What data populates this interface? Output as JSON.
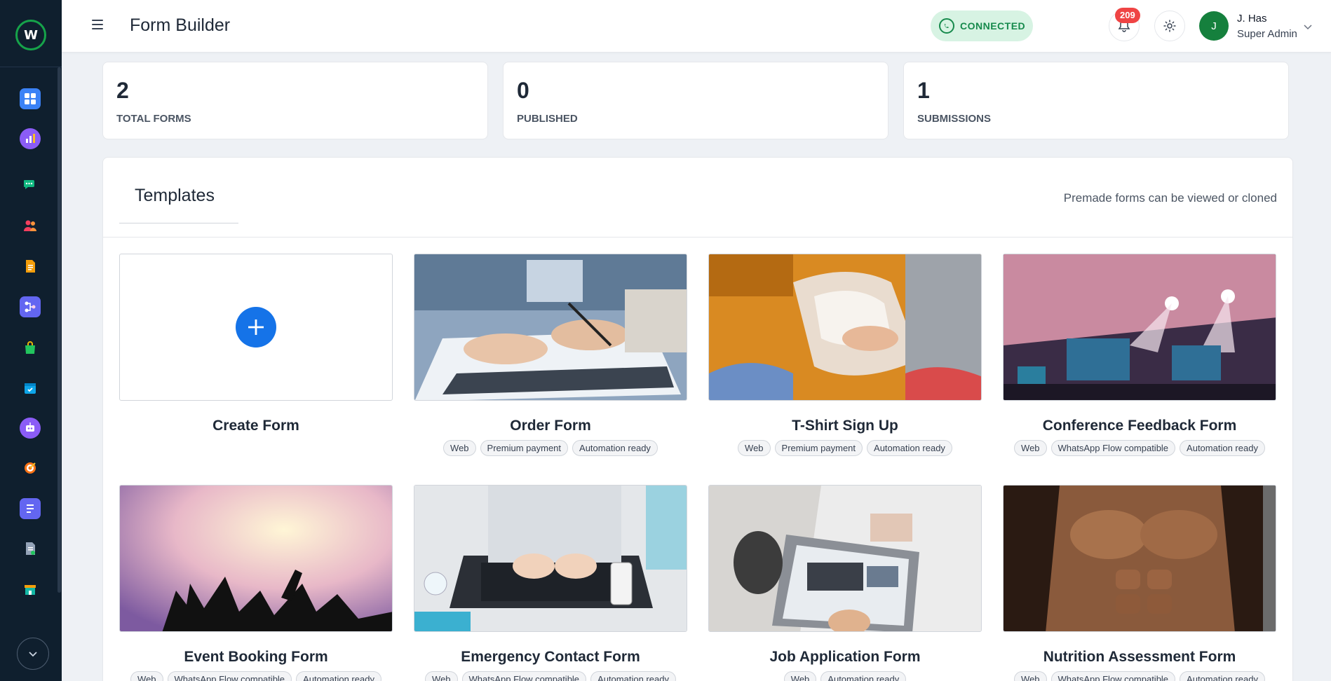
{
  "app": {
    "title": "Form Builder",
    "connection_status": "CONNECTED",
    "notification_count": "209",
    "user": {
      "name": "J. Has",
      "role": "Super Admin",
      "initial": "J"
    }
  },
  "sidebar": {
    "items": [
      {
        "icon": "dashboard-icon",
        "color": "#3b82f6"
      },
      {
        "icon": "analytics-icon",
        "color": "#8b5cf6"
      },
      {
        "icon": "chat-icon",
        "color": "#10b981"
      },
      {
        "icon": "contacts-icon",
        "color": "#f43f5e"
      },
      {
        "icon": "document-icon",
        "color": "#f59e0b"
      },
      {
        "icon": "flow-icon",
        "color": "#6366f1"
      },
      {
        "icon": "shop-icon",
        "color": "#22c55e"
      },
      {
        "icon": "calendar-icon",
        "color": "#0ea5e9"
      },
      {
        "icon": "bot-icon",
        "color": "#8b5cf6"
      },
      {
        "icon": "target-icon",
        "color": "#f97316"
      },
      {
        "icon": "form-icon",
        "color": "#6366f1"
      },
      {
        "icon": "report-icon",
        "color": "#64748b"
      },
      {
        "icon": "store-icon",
        "color": "#14b8a6"
      }
    ]
  },
  "stats": [
    {
      "value": "2",
      "label": "TOTAL FORMS"
    },
    {
      "value": "0",
      "label": "PUBLISHED"
    },
    {
      "value": "1",
      "label": "SUBMISSIONS"
    }
  ],
  "templates": {
    "title": "Templates",
    "hint": "Premade forms can be viewed or cloned",
    "create_label": "Create Form",
    "items": [
      {
        "name": "Order Form",
        "tags": [
          "Web",
          "Premium payment",
          "Automation ready"
        ]
      },
      {
        "name": "T-Shirt Sign Up",
        "tags": [
          "Web",
          "Premium payment",
          "Automation ready"
        ]
      },
      {
        "name": "Conference Feedback Form",
        "tags": [
          "Web",
          "WhatsApp Flow compatible",
          "Automation ready"
        ]
      },
      {
        "name": "Event Booking Form",
        "tags": [
          "Web",
          "WhatsApp Flow compatible",
          "Automation ready"
        ]
      },
      {
        "name": "Emergency Contact Form",
        "tags": [
          "Web",
          "WhatsApp Flow compatible",
          "Automation ready"
        ]
      },
      {
        "name": "Job Application Form",
        "tags": [
          "Web",
          "Automation ready"
        ]
      },
      {
        "name": "Nutrition Assessment Form",
        "tags": [
          "Web",
          "WhatsApp Flow compatible",
          "Automation ready"
        ]
      }
    ]
  }
}
